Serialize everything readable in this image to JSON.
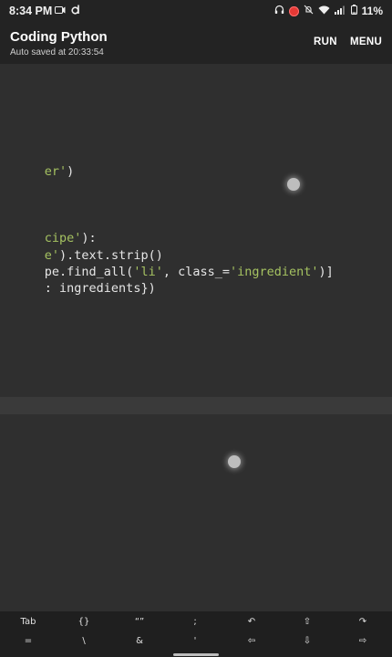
{
  "status_bar": {
    "time": "8:34 PM",
    "battery": "11%",
    "left_icons": [
      "screen-record-icon",
      "d-app-icon"
    ],
    "right_icons": [
      "headphones-icon",
      "record-indicator-icon",
      "mute-icon",
      "wifi-icon",
      "signal-icon",
      "battery-icon"
    ]
  },
  "app_bar": {
    "title": "Coding Python",
    "subtitle": "Auto saved at 20:33:54",
    "run_label": "RUN",
    "menu_label": "MENU"
  },
  "editor": {
    "lines": [
      {
        "parts": [
          {
            "text": "er'",
            "kind": "str"
          },
          {
            "text": ")",
            "kind": "plain"
          }
        ]
      },
      {
        "parts": [
          {
            "text": "cipe'",
            "kind": "str"
          },
          {
            "text": "):",
            "kind": "plain"
          }
        ]
      },
      {
        "parts": [
          {
            "text": "e'",
            "kind": "str"
          },
          {
            "text": ").text.strip()",
            "kind": "plain"
          }
        ]
      },
      {
        "parts": [
          {
            "text": "pe.find_all(",
            "kind": "plain"
          },
          {
            "text": "'li'",
            "kind": "str"
          },
          {
            "text": ", class_=",
            "kind": "plain"
          },
          {
            "text": "'ingredient'",
            "kind": "str"
          },
          {
            "text": ")]",
            "kind": "plain"
          }
        ]
      },
      {
        "parts": [
          {
            "text": ": ingredients})",
            "kind": "plain"
          }
        ]
      }
    ]
  },
  "extra_keys": {
    "row1": [
      "Tab",
      "{}",
      "“”",
      ";",
      "↶",
      "⇧",
      "↷"
    ],
    "row2": [
      "=",
      "\\",
      "&",
      "'",
      "⇦",
      "⇩",
      "⇨"
    ]
  },
  "colors": {
    "background": "#2f2f2f",
    "bar": "#232323",
    "string": "#a5c261",
    "text": "#e6e6e6"
  }
}
